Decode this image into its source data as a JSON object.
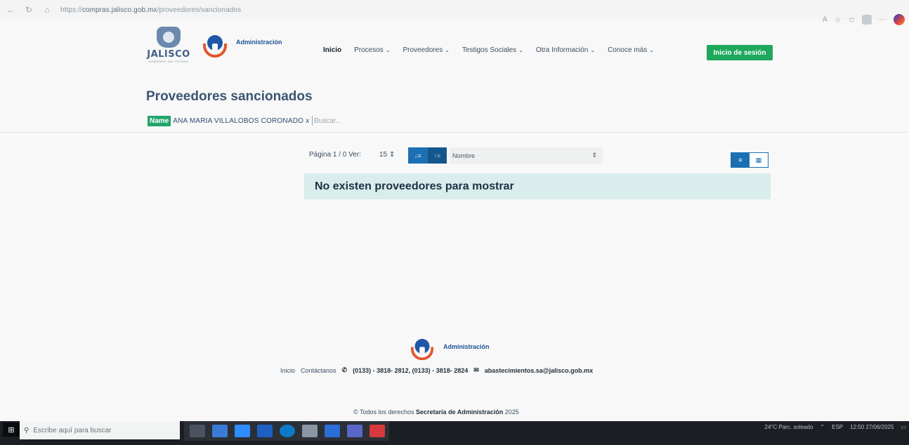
{
  "browser": {
    "url_prefix": "https://",
    "url_host": "compras.jalisco.gob.mx",
    "url_path": "/proveedores/sancionados"
  },
  "header": {
    "jalisco_word": "JALISCO",
    "jalisco_sub": "GOBIERNO DEL ESTADO",
    "admin_logo_text": "Administración",
    "nav": [
      {
        "label": "Inicio",
        "dropdown": false
      },
      {
        "label": "Procesos",
        "dropdown": true
      },
      {
        "label": "Proveedores",
        "dropdown": true
      },
      {
        "label": "Testigos Sociales",
        "dropdown": true
      },
      {
        "label": "Otra Información",
        "dropdown": true
      },
      {
        "label": "Conoce más",
        "dropdown": true
      }
    ],
    "login_label": "Inicio de sesión"
  },
  "main": {
    "title": "Proveedores sancionados",
    "filter_tag_key": "Name",
    "filter_tag_value": "ANA MARIA VILLALOBOS CORONADO",
    "filter_tag_remove": "x",
    "search_placeholder": "Buscar...",
    "pager_text": "Página 1 / 0 Ver:",
    "per_page_value": "15 ⇕",
    "sort_select_value": "Nombre",
    "empty_message": "No existen proveedores para mostrar"
  },
  "footer": {
    "logo_text": "Administración",
    "links": [
      "Inicio",
      "Contáctanos"
    ],
    "phone_text": "(0133) - 3818- 2812, (0133) - 3818- 2824",
    "email_text": "abastecimientos.sa@jalisco.gob.mx",
    "copyright_prefix": "© Todos los derechos",
    "copyright_org": "Secretaría de Administración",
    "copyright_year": "2025"
  },
  "taskbar": {
    "search_placeholder": "Escribe aquí para buscar",
    "weather_text": "24°C  Parc. soleado",
    "language": "ESP",
    "time": "12:50",
    "date": "27/06/2025"
  },
  "colors": {
    "accent_green": "#1da85c",
    "accent_blue": "#1c6fb3",
    "title_blue": "#3c5575",
    "alert_bg": "#d9edec"
  }
}
